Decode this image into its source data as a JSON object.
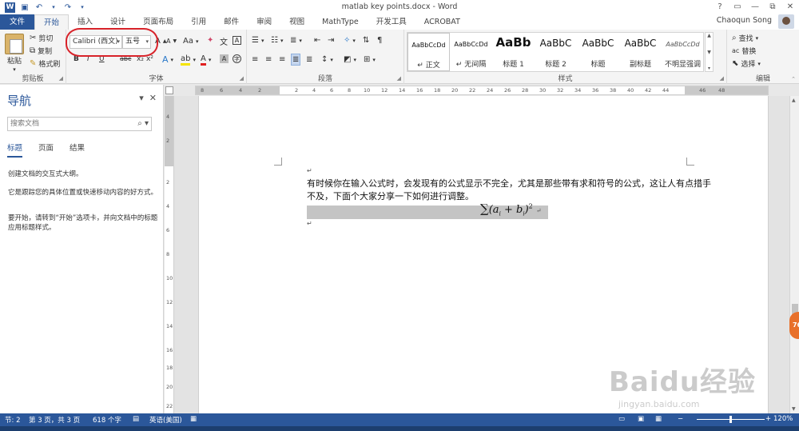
{
  "window": {
    "title": "matlab key points.docx - Word",
    "controls": [
      "?",
      "▭",
      "—",
      "⧉",
      "✕"
    ],
    "user": "Chaoqun Song"
  },
  "qat": {
    "save_icon": "save-icon",
    "undo_icon": "undo-icon",
    "redo_icon": "redo-icon"
  },
  "tabs": [
    "文件",
    "开始",
    "插入",
    "设计",
    "页面布局",
    "引用",
    "邮件",
    "审阅",
    "视图",
    "MathType",
    "开发工具",
    "ACROBAT"
  ],
  "clipboard": {
    "paste": "粘贴",
    "cut": "剪切",
    "copy": "复制",
    "format_painter": "格式刷",
    "label": "剪贴板"
  },
  "font": {
    "name": "Calibri (西文)",
    "size": "五号",
    "label": "字体",
    "bold": "B",
    "italic": "I",
    "underline": "U",
    "strike": "abc",
    "sub": "x₂",
    "sup": "x²",
    "grow": "A",
    "shrink": "A",
    "case": "Aa"
  },
  "paragraph": {
    "label": "段落"
  },
  "styles": {
    "label": "样式",
    "items": [
      {
        "sample": "AaBbCcDd",
        "name": "↵ 正文"
      },
      {
        "sample": "AaBbCcDd",
        "name": "↵ 无间隔"
      },
      {
        "sample": "AaBb",
        "name": "标题 1"
      },
      {
        "sample": "AaBbC",
        "name": "标题 2"
      },
      {
        "sample": "AaBbC",
        "name": "标题"
      },
      {
        "sample": "AaBbC",
        "name": "副标题"
      },
      {
        "sample": "AaBbCcDd",
        "name": "不明显强调"
      }
    ]
  },
  "editing": {
    "find": "查找",
    "replace": "替换",
    "select": "选择",
    "label": "编辑"
  },
  "nav": {
    "title": "导航",
    "search_placeholder": "搜索文档",
    "tabs": [
      "标题",
      "页面",
      "结果"
    ],
    "lines": [
      "创建文档的交互式大纲。",
      "它是跟踪您的具体位置或快速移动内容的好方式。",
      "要开始，请转到“开始”选项卡，并向文档中的标题应用标题样式。"
    ]
  },
  "ruler": {
    "h_labels": [
      "8",
      "6",
      "4",
      "2",
      "2",
      "4",
      "6",
      "8",
      "10",
      "12",
      "14",
      "16",
      "18",
      "20",
      "22",
      "24",
      "26",
      "28",
      "30",
      "32",
      "34",
      "36",
      "38",
      "40",
      "42",
      "44",
      "46",
      "48"
    ],
    "v_labels": [
      "4",
      "2",
      "2",
      "4",
      "6",
      "8",
      "10",
      "12",
      "14",
      "16",
      "18",
      "20",
      "22"
    ]
  },
  "document": {
    "paragraph": "有时候你在输入公式时，会发现有的公式显示不完全，尤其是那些带有求和符号的公式，这让人有点措手不及，下面个大家分享一下如何进行调整。",
    "para_mark": "↵",
    "equation": {
      "sigma": "∑",
      "a": "a",
      "b": "b",
      "sub": "i",
      "plus": " + ",
      "exp": "2"
    }
  },
  "status": {
    "section": "节: 2",
    "page": "第 3 页，共 3 页",
    "words": "618 个字",
    "language": "英语(美国)",
    "zoom": "120%"
  },
  "side_badge": "76",
  "watermark": {
    "brand": "Baidu经验",
    "url": "jingyan.baidu.com"
  }
}
